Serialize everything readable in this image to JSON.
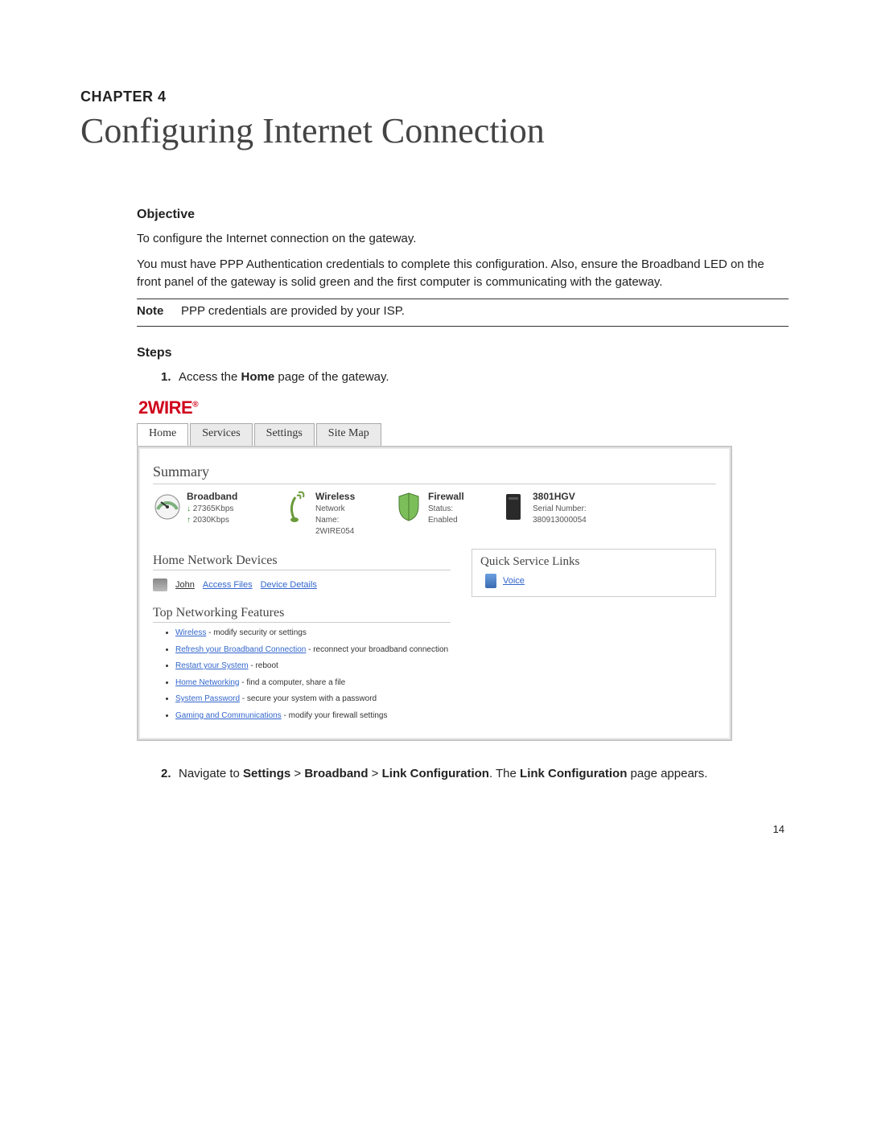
{
  "chapter": {
    "label": "CHAPTER 4",
    "title": "Configuring Internet Connection"
  },
  "objective": {
    "heading": "Objective",
    "p1": "To configure the Internet connection on the gateway.",
    "p2": "You must have PPP Authentication credentials to complete this configuration. Also, ensure the Broadband LED on the front panel of the gateway is solid green and the first computer is communicating with the gateway."
  },
  "note": {
    "label": "Note",
    "text": "PPP credentials are provided by your ISP."
  },
  "steps_heading": "Steps",
  "steps": {
    "s1": {
      "num": "1.",
      "pre": "Access the ",
      "bold1": "Home",
      "post": " page of the gateway."
    },
    "s2": {
      "num": "2.",
      "pre": "Navigate to ",
      "b1": "Settings",
      "sep1": " > ",
      "b2": "Broadband",
      "sep2": " > ",
      "b3": "Link Configuration",
      "mid": ". The ",
      "b4": "Link Configuration",
      "post": " page appears."
    }
  },
  "page_number": "14",
  "gateway": {
    "logo": "2WIRE",
    "logo_reg": "®",
    "tabs": [
      "Home",
      "Services",
      "Settings",
      "Site Map"
    ],
    "summary_title": "Summary",
    "broadband": {
      "title": "Broadband",
      "down": "27365Kbps",
      "up": "2030Kbps"
    },
    "wireless": {
      "title": "Wireless",
      "l1": "Network",
      "l2": "Name:",
      "l3": "2WIRE054"
    },
    "firewall": {
      "title": "Firewall",
      "l1": "Status:",
      "l2": "Enabled"
    },
    "model": {
      "title": "3801HGV",
      "l1": "Serial Number:",
      "l2": "380913000054"
    },
    "hnd_title": "Home Network Devices",
    "device": {
      "name": "John",
      "link1": "Access Files",
      "link2": "Device Details"
    },
    "tnf_title": "Top Networking Features",
    "features": [
      {
        "link": "Wireless",
        "desc": " - modify security or settings"
      },
      {
        "link": "Refresh your Broadband Connection",
        "desc": " - reconnect your broadband connection"
      },
      {
        "link": "Restart your System",
        "desc": " - reboot"
      },
      {
        "link": "Home Networking",
        "desc": " - find a computer, share a file"
      },
      {
        "link": "System Password",
        "desc": " - secure your system with a password"
      },
      {
        "link": "Gaming and Communications",
        "desc": " - modify your firewall settings"
      }
    ],
    "qsl": {
      "title": "Quick Service Links",
      "item": "Voice"
    }
  }
}
